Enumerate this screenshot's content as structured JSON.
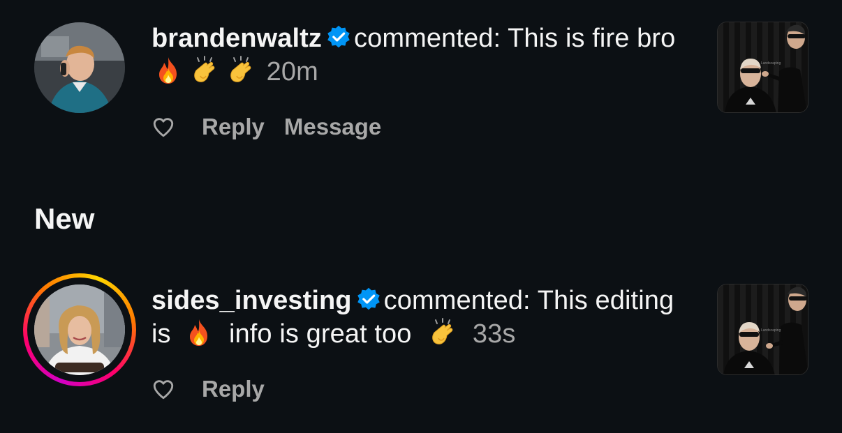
{
  "notifications_earlier": [
    {
      "username": "brandenwaltz",
      "verified": true,
      "action_text": "commented:",
      "comment_part1": "This is fire bro",
      "emojis": [
        "fire",
        "clapping-hands",
        "clapping-hands"
      ],
      "timestamp": "20m",
      "actions": {
        "like_icon": "heart-outline-icon",
        "reply_label": "Reply",
        "message_label": "Message"
      }
    }
  ],
  "section_new": {
    "title": "New"
  },
  "notifications_new": [
    {
      "username": "sides_investing",
      "verified": true,
      "has_story": true,
      "action_text": "commented:",
      "comment_part1": "This editing is",
      "comment_part2": "info is great too",
      "emojis": [
        "fire",
        "clapping-hands"
      ],
      "timestamp": "33s",
      "actions": {
        "like_icon": "heart-outline-icon",
        "reply_label": "Reply"
      }
    }
  ],
  "colors": {
    "background": "#0c1014",
    "text_primary": "#f5f5f5",
    "text_secondary": "#a8a8a8",
    "verified_blue": "#0095f6"
  }
}
